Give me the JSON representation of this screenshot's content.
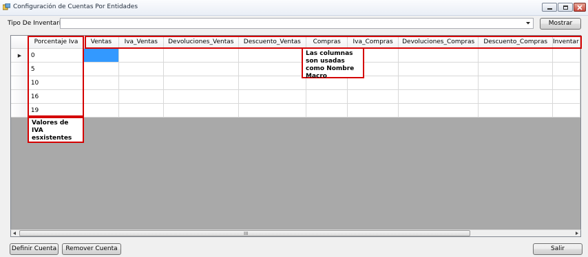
{
  "window": {
    "title": "Configuración de Cuentas Por Entidades",
    "controls": [
      "minimize-icon",
      "maximize-icon",
      "close-icon"
    ]
  },
  "toolbar": {
    "tipo_label": "Tipo De Inventario",
    "tipo_value": "",
    "mostrar_label": "Mostrar"
  },
  "grid": {
    "columns": [
      "Porcentaje Iva",
      "Ventas",
      "Iva_Ventas",
      "Devoluciones_Ventas",
      "Descuento_Ventas",
      "Compras",
      "Iva_Compras",
      "Devoluciones_Compras",
      "Descuento_Compras",
      "Inventar"
    ],
    "rows": [
      {
        "porcentaje": "0"
      },
      {
        "porcentaje": "5"
      },
      {
        "porcentaje": "10"
      },
      {
        "porcentaje": "16"
      },
      {
        "porcentaje": "19"
      }
    ],
    "current_row_marker": "current-row-arrow-icon",
    "scroll_grip": "III"
  },
  "annotations": {
    "columns_note": "Las columnas son usadas como Nombre Macro",
    "values_note": "Valores de IVA esxistentes",
    "color": "#d40000"
  },
  "footer": {
    "definir_label": "Definir Cuenta",
    "remover_label": "Remover Cuenta",
    "salir_label": "Salir"
  },
  "colors": {
    "selection": "#3399ff",
    "grid_background": "#a9a9a9"
  }
}
